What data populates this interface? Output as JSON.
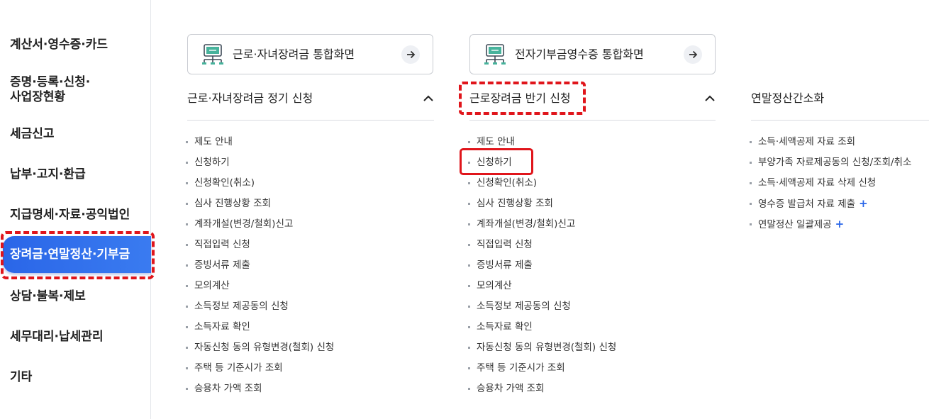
{
  "sidebar": {
    "items": [
      {
        "label": "계산서·영수증·카드"
      },
      {
        "label": "증명·등록·신청·\n사업장현황"
      },
      {
        "label": "세금신고"
      },
      {
        "label": "납부·고지·환급"
      },
      {
        "label": "지급명세·자료·공익법인"
      },
      {
        "label": "장려금·연말정산·기부금"
      },
      {
        "label": "상담·불복·제보"
      },
      {
        "label": "세무대리·납세관리"
      },
      {
        "label": "기타"
      }
    ]
  },
  "cards": [
    {
      "label": "근로·자녀장려금 통합화면"
    },
    {
      "label": "전자기부금영수증 통합화면"
    }
  ],
  "columns": [
    {
      "title": "근로·자녀장려금 정기 신청",
      "items": [
        {
          "label": "제도 안내"
        },
        {
          "label": "신청하기"
        },
        {
          "label": "신청확인(취소)"
        },
        {
          "label": "심사 진행상황 조회"
        },
        {
          "label": "계좌개설(변경/철회)신고"
        },
        {
          "label": "직접입력 신청"
        },
        {
          "label": "증빙서류 제출"
        },
        {
          "label": "모의계산"
        },
        {
          "label": "소득정보 제공동의 신청"
        },
        {
          "label": "소득자료 확인"
        },
        {
          "label": "자동신청 동의 유형변경(철회) 신청"
        },
        {
          "label": "주택 등 기준시가 조회"
        },
        {
          "label": "승용차 가액 조회"
        }
      ]
    },
    {
      "title": "근로장려금 반기 신청",
      "items": [
        {
          "label": "제도 안내"
        },
        {
          "label": "신청하기"
        },
        {
          "label": "신청확인(취소)"
        },
        {
          "label": "심사 진행상황 조회"
        },
        {
          "label": "계좌개설(변경/철회)신고"
        },
        {
          "label": "직접입력 신청"
        },
        {
          "label": "증빙서류 제출"
        },
        {
          "label": "모의계산"
        },
        {
          "label": "소득정보 제공동의 신청"
        },
        {
          "label": "소득자료 확인"
        },
        {
          "label": "자동신청 동의 유형변경(철회) 신청"
        },
        {
          "label": "주택 등 기준시가 조회"
        },
        {
          "label": "승용차 가액 조회"
        }
      ]
    },
    {
      "title": "연말정산간소화",
      "items": [
        {
          "label": "소득·세액공제 자료 조회"
        },
        {
          "label": "부양가족 자료제공동의 신청/조회/취소"
        },
        {
          "label": "소득·세액공제 자료 삭제 신청"
        },
        {
          "label": "영수증 발급처 자료 제출",
          "plus": "+"
        },
        {
          "label": "연말정산 일괄제공",
          "plus": "+"
        }
      ]
    }
  ],
  "colors": {
    "active_nav": "#2a66e8",
    "highlight": "#e0151b",
    "plus": "#2a66e8"
  }
}
